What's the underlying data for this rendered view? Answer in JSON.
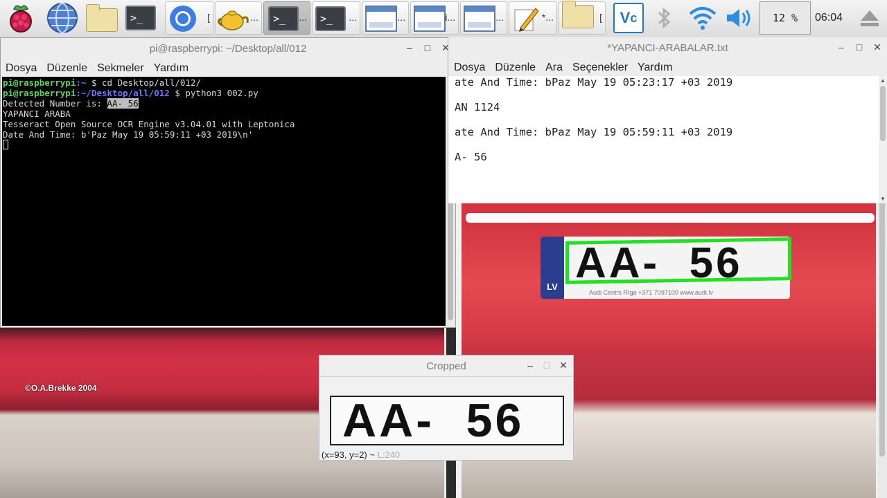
{
  "taskbar": {
    "items": [
      {
        "name": "raspberry-menu",
        "label": ""
      },
      {
        "name": "web-browser",
        "label": ""
      },
      {
        "name": "file-manager",
        "label": ""
      },
      {
        "name": "terminal-launcher",
        "label": ""
      },
      {
        "name": "chromium-task",
        "label": "["
      },
      {
        "name": "teapot-task",
        "label": "..."
      },
      {
        "name": "terminal-task-1",
        "label": "..."
      },
      {
        "name": "terminal-task-2",
        "label": "..."
      },
      {
        "name": "window-task-1",
        "label": "..."
      },
      {
        "name": "window-task-2",
        "label": "i..."
      },
      {
        "name": "window-task-3",
        "label": "..."
      },
      {
        "name": "editor-task",
        "label": "*..."
      },
      {
        "name": "folder-task",
        "label": "["
      }
    ],
    "cpu_label": "12 %",
    "clock": "06:04"
  },
  "terminal": {
    "title": "pi@raspberrypi: ~/Desktop/all/012",
    "menu": [
      "Dosya",
      "Düzenle",
      "Sekmeler",
      "Yardım"
    ],
    "lines": [
      {
        "user": "pi@raspberrypi",
        "path": ":~",
        "cmd": " $ cd Desktop/all/012/"
      },
      {
        "user": "pi@raspberrypi",
        "path": ":~/Desktop/all/012",
        "cmd": " $ python3 002.py"
      }
    ],
    "detected_prefix": "Detected Number is: ",
    "detected_value": "AA- 56",
    "out1": "YAPANCI ARABA",
    "out2": "Tesseract Open Source OCR Engine v3.04.01 with Leptonica",
    "out3": "Date And Time: b'Paz May 19 05:59:11 +03 2019\\n'"
  },
  "editor": {
    "title": "*YAPANCI-ARABALAR.txt",
    "menu": [
      "Dosya",
      "Düzenle",
      "Ara",
      "Seçenekler",
      "Yardım"
    ],
    "lines": [
      "ate And Time: bPaz May 19 05:23:17 +03 2019",
      "AN 1124",
      "ate And Time: bPaz May 19 05:59:11 +03 2019",
      "A- 56"
    ]
  },
  "left_image": {
    "watermark": "©O.A.Brekke 2004"
  },
  "car_image": {
    "plate_text": "AA-  56",
    "plate_country": "LV",
    "dealer": "Audi Centrs Rīga   +371 7097100   www.audi.lv"
  },
  "cropped": {
    "title": "Cropped",
    "plate_text": "AA-  56",
    "status_coords": "(x=93, y=2) ~",
    "status_l": "L:240"
  },
  "colors": {
    "detect_box": "#23e023",
    "prompt_user": "#5fd75f",
    "prompt_path": "#6c78ff"
  }
}
